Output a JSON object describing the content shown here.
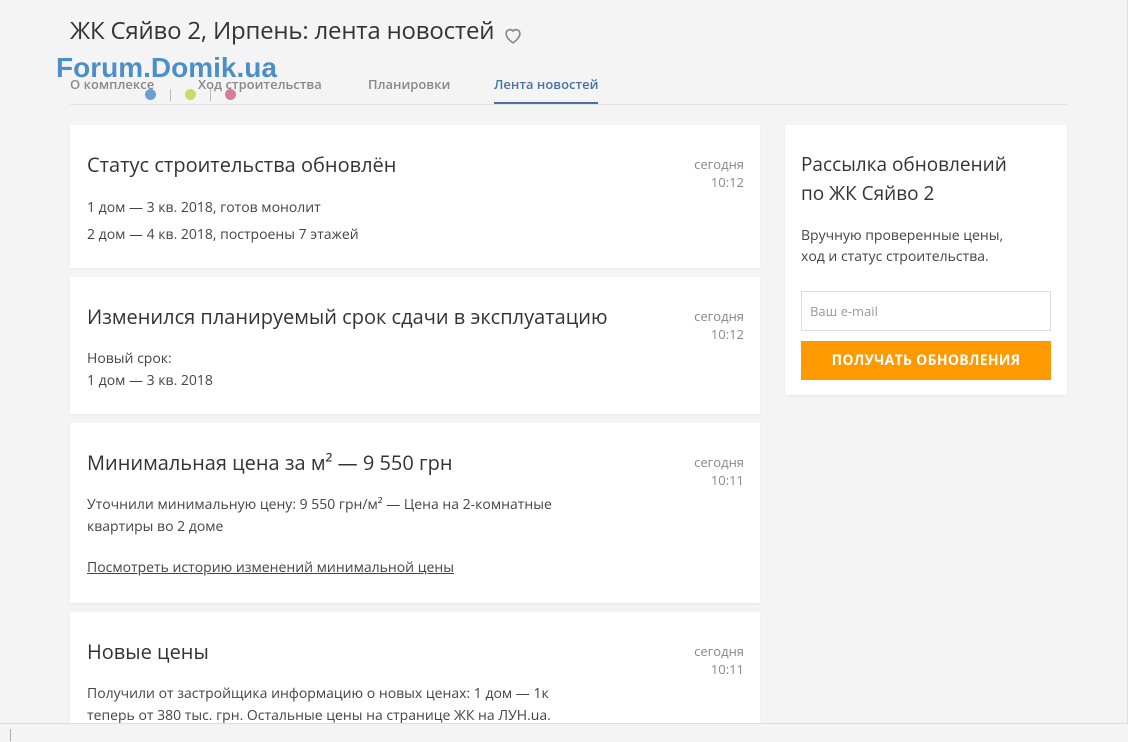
{
  "page": {
    "title": "ЖК Сяйво 2, Ирпень: лента новостей",
    "favorite_icon": "heart-icon"
  },
  "watermark": {
    "text": "Forum.Domik.ua",
    "dot_colors": [
      "#6a9fd4",
      "#cfd86a",
      "#d97b9a"
    ]
  },
  "tabs": [
    {
      "label": "О комплексе",
      "active": false
    },
    {
      "label": "Ход строительства",
      "active": false
    },
    {
      "label": "Планировки",
      "active": false
    },
    {
      "label": "Лента новостей",
      "active": true
    }
  ],
  "feed": [
    {
      "title": "Статус строительства обновлён",
      "day": "сегодня",
      "time": "10:12",
      "lines": [
        "1 дом — 3 кв. 2018, готов монолит",
        "2 дом — 4 кв. 2018, построены 7 этажей"
      ]
    },
    {
      "title": "Изменился планируемый срок сдачи в эксплуатацию",
      "day": "сегодня",
      "time": "10:12",
      "lines": [
        "Новый срок:",
        "1 дом — 3 кв. 2018"
      ]
    },
    {
      "title": "Минимальная цена за м² — 9 550 грн",
      "day": "сегодня",
      "time": "10:11",
      "lines": [
        "Уточнили минимальную цену: 9 550 грн/м² — Цена на 2-комнатные",
        "квартиры во 2 доме"
      ],
      "link": "Посмотреть историю изменений минимальной цены"
    },
    {
      "title": "Новые цены",
      "day": "сегодня",
      "time": "10:11",
      "lines": [
        "Получили от застройщика информацию о новых ценах: 1 дом — 1к",
        "теперь от 380 тыс. грн. Остальные цены на странице ЖК на ЛУН.ua."
      ]
    }
  ],
  "subscribe": {
    "title_line1": "Рассылка обновлений",
    "title_line2": "по ЖК Сяйво 2",
    "desc_line1": "Вручную проверенные цены,",
    "desc_line2": "ход и статус строительства.",
    "email_placeholder": "Ваш e-mail",
    "button_label": "ПОЛУЧАТЬ ОБНОВЛЕНИЯ",
    "button_color": "#ff9900"
  },
  "colors": {
    "accent": "#4672a9",
    "background": "#f4f4f4"
  }
}
